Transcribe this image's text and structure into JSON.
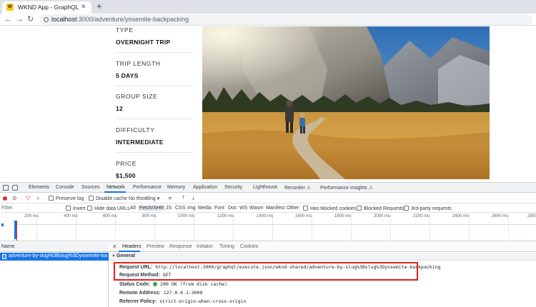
{
  "browser": {
    "tab_title": "WKND App - GraphQL",
    "favicon_text": "W",
    "url_host": "localhost",
    "url_path": ":3000/adventure/yosemite-backpacking"
  },
  "page": {
    "details": [
      {
        "label": "TYPE",
        "value": "OVERNIGHT TRIP"
      },
      {
        "label": "TRIP LENGTH",
        "value": "5 DAYS"
      },
      {
        "label": "GROUP SIZE",
        "value": "12"
      },
      {
        "label": "DIFFICULTY",
        "value": "INTERMEDIATE"
      },
      {
        "label": "PRICE",
        "value": "$1,500"
      }
    ]
  },
  "devtools": {
    "tabs": [
      "Elements",
      "Console",
      "Sources",
      "Network",
      "Performance",
      "Memory",
      "Application",
      "Security",
      "Lighthouse",
      "Recorder ⚠",
      "Performance insights ⚠"
    ],
    "active_tab": "Network",
    "toolbar": {
      "preserve_log": "Preserve log",
      "disable_cache": "Disable cache",
      "throttling": "No throttling"
    },
    "filter": {
      "label": "Filter",
      "invert": "Invert",
      "hide_data_urls": "Hide data URLs",
      "types": [
        "All",
        "Fetch/XHR",
        "JS",
        "CSS",
        "Img",
        "Media",
        "Font",
        "Doc",
        "WS",
        "Wasm",
        "Manifest",
        "Other"
      ],
      "selected_type": "Fetch/XHR",
      "has_blocked_cookies": "Has blocked cookies",
      "blocked_requests": "Blocked Requests",
      "third_party": "3rd-party requests"
    },
    "timeline_ticks": [
      "200 ms",
      "400 ms",
      "600 ms",
      "800 ms",
      "1000 ms",
      "1200 ms",
      "1400 ms",
      "1600 ms",
      "1800 ms",
      "2000 ms",
      "2200 ms",
      "2400 ms",
      "2600 ms",
      "2800"
    ],
    "list": {
      "header": "Name",
      "rows": [
        "adventure-by-slug%3Bslug%3Dyosemite-bac..."
      ]
    },
    "details": {
      "tabs": [
        "Headers",
        "Preview",
        "Response",
        "Initiator",
        "Timing",
        "Cookies"
      ],
      "active_tab": "Headers",
      "section_title": "General",
      "request_url_key": "Request URL:",
      "request_url": "http://localhost:3000/graphql/execute.json/wknd-shared/adventure-by-slug%3Bslug%3Dyosemite-backpacking",
      "request_method_key": "Request Method:",
      "request_method": "GET",
      "status_code_key": "Status Code:",
      "status_code": "200 OK (from disk cache)",
      "remote_address_key": "Remote Address:",
      "remote_address": "127.0.0.1:3000",
      "referrer_policy_key": "Referrer Policy:",
      "referrer_policy": "strict-origin-when-cross-origin"
    }
  },
  "colors": {
    "highlight": "#e0201b",
    "accent": "#1a73e8",
    "status_ok": "#34a853"
  }
}
